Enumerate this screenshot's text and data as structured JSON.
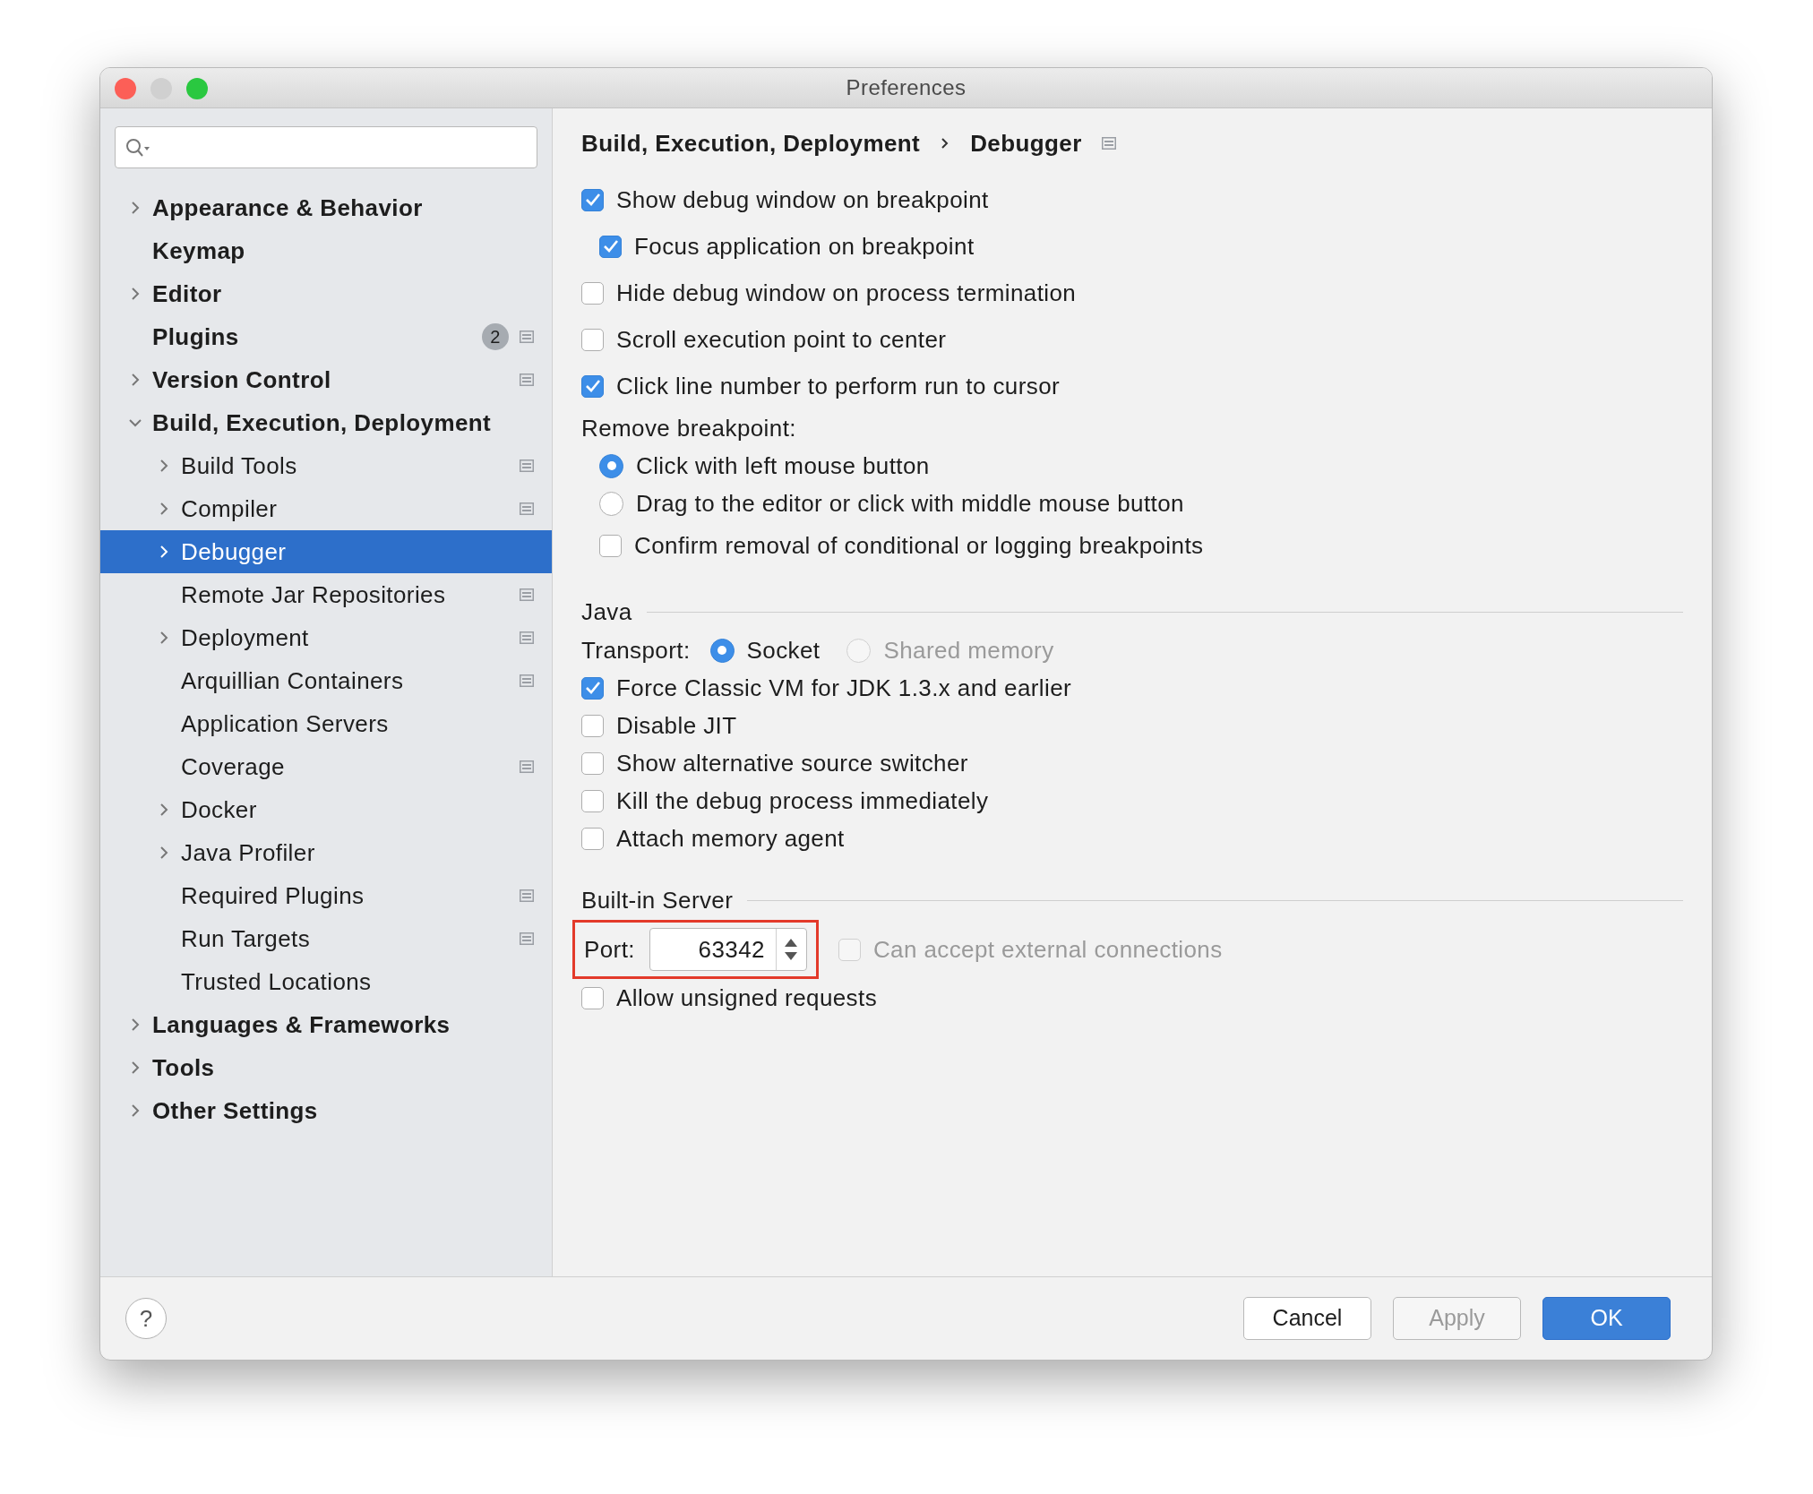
{
  "window": {
    "title": "Preferences"
  },
  "sidebar": {
    "items": [
      {
        "label": "Appearance & Behavior",
        "expanded": false,
        "selected": false,
        "scoped": false
      },
      {
        "label": "Keymap",
        "selected": false,
        "scoped": false
      },
      {
        "label": "Editor",
        "expanded": false,
        "selected": false,
        "scoped": false
      },
      {
        "label": "Plugins",
        "badge": "2",
        "selected": false,
        "scoped": true
      },
      {
        "label": "Version Control",
        "expanded": false,
        "selected": false,
        "scoped": true
      },
      {
        "label": "Build, Execution, Deployment",
        "expanded": true,
        "selected": false,
        "scoped": false,
        "children": [
          {
            "label": "Build Tools",
            "expanded": false,
            "selected": false,
            "scoped": true
          },
          {
            "label": "Compiler",
            "expanded": false,
            "selected": false,
            "scoped": true
          },
          {
            "label": "Debugger",
            "expanded": false,
            "selected": true,
            "scoped": false
          },
          {
            "label": "Remote Jar Repositories",
            "selected": false,
            "scoped": true
          },
          {
            "label": "Deployment",
            "expanded": false,
            "selected": false,
            "scoped": true
          },
          {
            "label": "Arquillian Containers",
            "selected": false,
            "scoped": true
          },
          {
            "label": "Application Servers",
            "selected": false,
            "scoped": false
          },
          {
            "label": "Coverage",
            "selected": false,
            "scoped": true
          },
          {
            "label": "Docker",
            "expanded": false,
            "selected": false,
            "scoped": false
          },
          {
            "label": "Java Profiler",
            "expanded": false,
            "selected": false,
            "scoped": false
          },
          {
            "label": "Required Plugins",
            "selected": false,
            "scoped": true
          },
          {
            "label": "Run Targets",
            "selected": false,
            "scoped": true
          },
          {
            "label": "Trusted Locations",
            "selected": false,
            "scoped": false
          }
        ]
      },
      {
        "label": "Languages & Frameworks",
        "expanded": false,
        "selected": false,
        "scoped": false
      },
      {
        "label": "Tools",
        "expanded": false,
        "selected": false,
        "scoped": false
      },
      {
        "label": "Other Settings",
        "expanded": false,
        "selected": false,
        "scoped": false
      }
    ]
  },
  "breadcrumb": [
    "Build, Execution, Deployment",
    "Debugger"
  ],
  "settings": [
    {
      "kind": "checkbox",
      "label": "Show debug window on breakpoint",
      "checked": true,
      "children": [
        {
          "kind": "checkbox",
          "label": "Focus application on breakpoint",
          "checked": true
        }
      ]
    },
    {
      "kind": "checkbox",
      "label": "Hide debug window on process termination",
      "checked": false
    },
    {
      "kind": "checkbox",
      "label": "Scroll execution point to center",
      "checked": false
    },
    {
      "kind": "checkbox",
      "label": "Click line number to perform run to cursor",
      "checked": true
    },
    {
      "kind": "label",
      "label": "Remove breakpoint:",
      "children": [
        {
          "kind": "radio",
          "label": "Click with left mouse button",
          "selected": true
        },
        {
          "kind": "radio",
          "label": "Drag to the editor or click with middle mouse button",
          "selected": false
        },
        {
          "kind": "checkbox",
          "label": "Confirm removal of conditional or logging breakpoints",
          "checked": false
        }
      ]
    },
    {
      "kind": "section",
      "label": "Java"
    },
    {
      "kind": "radio_group",
      "label": "Transport:",
      "options": [
        {
          "label": "Socket",
          "selected": true,
          "disabled": false
        },
        {
          "label": "Shared memory",
          "selected": false,
          "disabled": true
        }
      ]
    },
    {
      "kind": "checkbox",
      "label": "Force Classic VM for JDK 1.3.x and earlier",
      "checked": true
    },
    {
      "kind": "checkbox",
      "label": "Disable JIT",
      "checked": false
    },
    {
      "kind": "checkbox",
      "label": "Show alternative source switcher",
      "checked": false
    },
    {
      "kind": "checkbox",
      "label": "Kill the debug process immediately",
      "checked": false
    },
    {
      "kind": "checkbox",
      "label": "Attach memory agent",
      "checked": false
    },
    {
      "kind": "section",
      "label": "Built-in Server"
    },
    {
      "kind": "port",
      "label": "Port:",
      "value": "63342",
      "highlighted": true,
      "checkbox": {
        "label": "Can accept external connections",
        "checked": false,
        "disabled": true
      }
    },
    {
      "kind": "checkbox",
      "label": "Allow unsigned requests",
      "checked": false
    }
  ],
  "buttons": [
    {
      "label": "Cancel",
      "kind": "default",
      "disabled": false
    },
    {
      "label": "Apply",
      "kind": "default",
      "disabled": true
    },
    {
      "label": "OK",
      "kind": "primary",
      "disabled": false
    }
  ],
  "help": {
    "label": "?"
  }
}
